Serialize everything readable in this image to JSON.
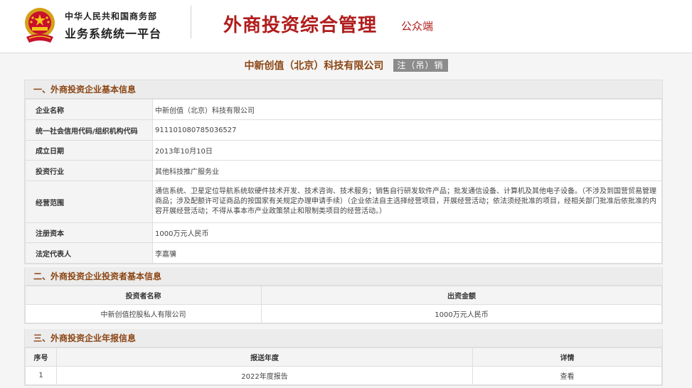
{
  "header": {
    "org_line1": "中华人民共和国商务部",
    "org_line2": "业务系统统一平台",
    "title": "外商投资综合管理",
    "subtitle": "公众端"
  },
  "company": {
    "name": "中新创值（北京）科技有限公司",
    "status": "注（吊）销"
  },
  "section1": {
    "title": "一、外商投资企业基本信息",
    "rows": [
      {
        "label": "企业名称",
        "value": "中新创值（北京）科技有限公司"
      },
      {
        "label": "统一社会信用代码/组织机构代码",
        "value": "911101080785036527"
      },
      {
        "label": "成立日期",
        "value": "2013年10月10日"
      },
      {
        "label": "投资行业",
        "value": "其他科技推广服务业"
      },
      {
        "label": "经营范围",
        "value": "通信系统、卫星定位导航系统软硬件技术开发、技术咨询、技术服务；销售自行研发软件产品；批发通信设备、计算机及其他电子设备。（不涉及到国营贸易管理商品；涉及配额许可证商品的按国家有关规定办理申请手续）（企业依法自主选择经营项目，开展经营活动；依法须经批准的项目，经相关部门批准后依批准的内容开展经营活动；不得从事本市产业政策禁止和限制类项目的经营活动。）"
      },
      {
        "label": "注册资本",
        "value": "1000万元人民币"
      },
      {
        "label": "法定代表人",
        "value": "李嘉骥"
      }
    ]
  },
  "section2": {
    "title": "二、外商投资企业投资者基本信息",
    "headers": [
      "投资者名称",
      "出资金额"
    ],
    "rows": [
      [
        "中新创值控股私人有限公司",
        "1000万元人民币"
      ]
    ]
  },
  "section3": {
    "title": "三、外商投资企业年报信息",
    "headers": [
      "序号",
      "报送年度",
      "详情"
    ],
    "rows": [
      [
        "1",
        "2022年度报告",
        "查看"
      ]
    ]
  },
  "colors": {
    "brand_red": "#b01d1d",
    "section_brown": "#8b4513",
    "badge_gray": "#8c8c8c"
  }
}
